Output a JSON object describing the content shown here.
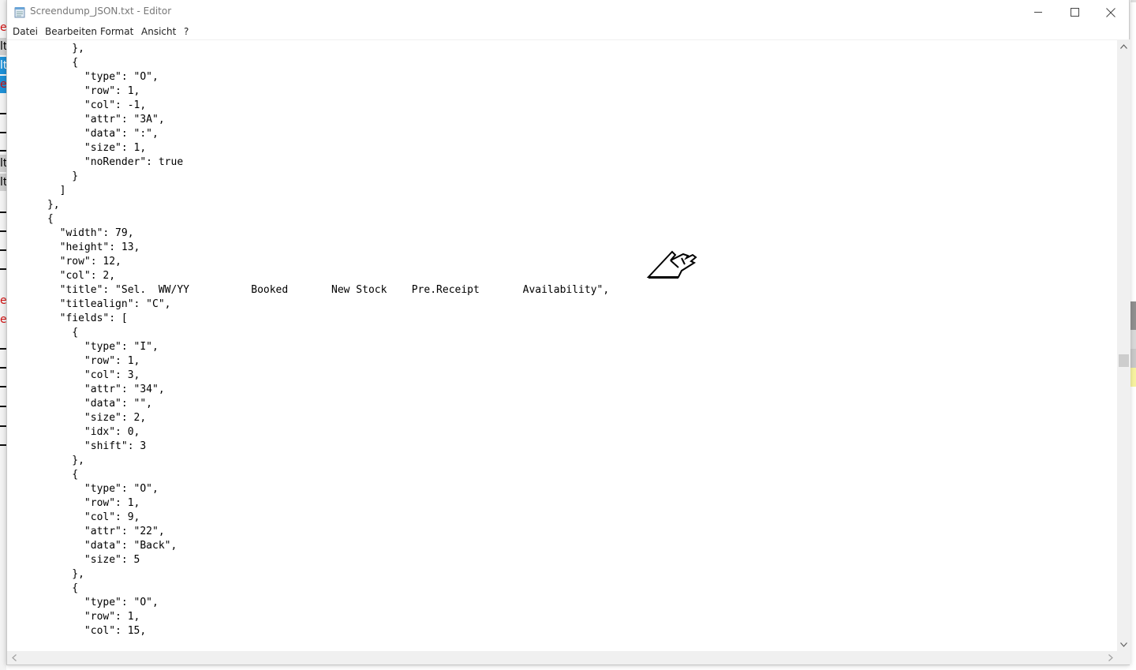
{
  "window": {
    "title": "Screendump_JSON.txt - Editor",
    "controls": {
      "minimize": "—",
      "maximize": "☐",
      "close": "✕"
    }
  },
  "menu": {
    "items": [
      "Datei",
      "Bearbeiten",
      "Format",
      "Ansicht",
      "?"
    ]
  },
  "background_window": {
    "visible_glyphs": [
      "e",
      "lt",
      "lt",
      "e",
      "lt",
      "lt",
      "e",
      "e"
    ]
  },
  "editor": {
    "content": "          },\n          {\n            \"type\": \"O\",\n            \"row\": 1,\n            \"col\": -1,\n            \"attr\": \"3A\",\n            \"data\": \":\",\n            \"size\": 1,\n            \"noRender\": true\n          }\n        ]\n      },\n      {\n        \"width\": 79,\n        \"height\": 13,\n        \"row\": 12,\n        \"col\": 2,\n        \"title\": \"Sel.  WW/YY          Booked       New Stock    Pre.Receipt       Availability\",\n        \"titlealign\": \"C\",\n        \"fields\": [\n          {\n            \"type\": \"I\",\n            \"row\": 1,\n            \"col\": 3,\n            \"attr\": \"34\",\n            \"data\": \"\",\n            \"size\": 2,\n            \"idx\": 0,\n            \"shift\": 3\n          },\n          {\n            \"type\": \"O\",\n            \"row\": 1,\n            \"col\": 9,\n            \"attr\": \"22\",\n            \"data\": \"Back\",\n            \"size\": 5\n          },\n          {\n            \"type\": \"O\",\n            \"row\": 1,\n            \"col\": 15,"
  },
  "icons": {
    "app": "notepad-icon",
    "cursor": "hand-pointer-cursor-icon",
    "scroll_up": "chevron-up-icon",
    "scroll_down": "chevron-down-icon",
    "scroll_left": "chevron-left-icon",
    "scroll_right": "chevron-right-icon"
  },
  "colors": {
    "background_highlight": "#1e90d6",
    "background_red_text": "#d01010",
    "right_strip_yellow": "#f6f3a0"
  }
}
